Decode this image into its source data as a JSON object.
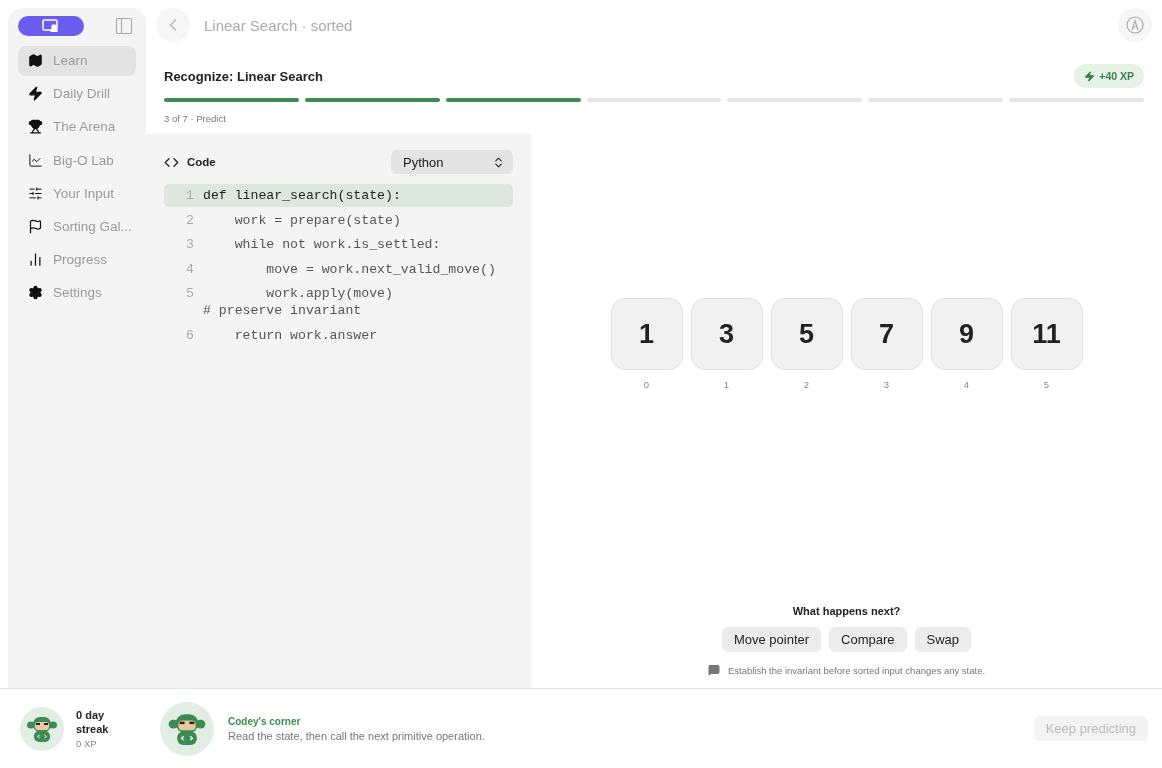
{
  "header": {
    "title": "Linear Search · sorted"
  },
  "sidebar": {
    "items": [
      {
        "label": "Learn",
        "selected": true
      },
      {
        "label": "Daily Drill",
        "selected": false
      },
      {
        "label": "The Arena",
        "selected": false
      },
      {
        "label": "Big-O Lab",
        "selected": false
      },
      {
        "label": "Your Input",
        "selected": false
      },
      {
        "label": "Sorting Gal...",
        "selected": false
      },
      {
        "label": "Progress",
        "selected": false
      },
      {
        "label": "Settings",
        "selected": false
      }
    ],
    "streak": {
      "title": "0 day streak",
      "xp": "0 XP"
    }
  },
  "lesson": {
    "title": "Recognize: Linear Search",
    "xp_badge": "+40 XP",
    "step_label": "3 of 7 · Predict",
    "steps": [
      {
        "done": true
      },
      {
        "done": true
      },
      {
        "done": true
      },
      {
        "done": false
      },
      {
        "done": false
      },
      {
        "done": false
      },
      {
        "done": false
      }
    ]
  },
  "code": {
    "title": "Code",
    "language": "Python",
    "lines": [
      {
        "number": "1",
        "text": "def linear_search(state):",
        "highlighted": true
      },
      {
        "number": "2",
        "text": "    work = prepare(state)",
        "highlighted": false
      },
      {
        "number": "3",
        "text": "    while not work.is_settled:",
        "highlighted": false
      },
      {
        "number": "4",
        "text": "        move = work.next_valid_move()",
        "highlighted": false
      },
      {
        "number": "5",
        "text": "        work.apply(move)  ",
        "comment": "# preserve invariant",
        "highlighted": false
      },
      {
        "number": "6",
        "text": "    return work.answer",
        "highlighted": false
      }
    ]
  },
  "array": [
    {
      "value": "1",
      "index": "0"
    },
    {
      "value": "3",
      "index": "1"
    },
    {
      "value": "5",
      "index": "2"
    },
    {
      "value": "7",
      "index": "3"
    },
    {
      "value": "9",
      "index": "4"
    },
    {
      "value": "11",
      "index": "5"
    }
  ],
  "question": {
    "prompt": "What happens next?",
    "options": [
      "Move pointer",
      "Compare",
      "Swap"
    ],
    "hint": "Establish the invariant before sorted input changes any state."
  },
  "footer": {
    "coach_title": "Codey's corner",
    "coach_text": "Read the state, then call the next primitive operation.",
    "next_button": {
      "label": "Keep predicting",
      "disabled": true
    }
  }
}
